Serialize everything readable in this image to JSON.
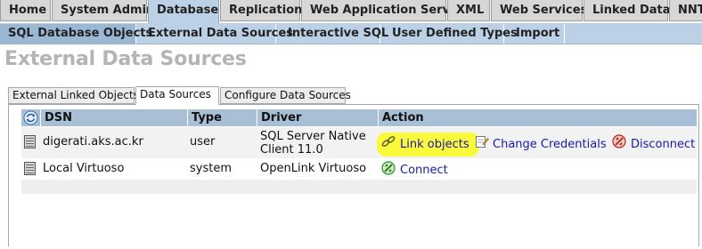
{
  "top_tabs": [
    {
      "label": "Home",
      "active": false
    },
    {
      "label": "System Admin",
      "active": false
    },
    {
      "label": "Database",
      "active": true
    },
    {
      "label": "Replication",
      "active": false
    },
    {
      "label": "Web Application Server",
      "active": false
    },
    {
      "label": "XML",
      "active": false
    },
    {
      "label": "Web Services",
      "active": false
    },
    {
      "label": "Linked Data",
      "active": false
    },
    {
      "label": "NNTP",
      "active": false
    }
  ],
  "sub_tabs": [
    {
      "label": "SQL Database Objects",
      "active": true
    },
    {
      "label": "External Data Sources",
      "active": false
    },
    {
      "label": "Interactive SQL",
      "active": false
    },
    {
      "label": "User Defined Types",
      "active": false
    },
    {
      "label": "Import",
      "active": false
    }
  ],
  "page_title": "External Data Sources",
  "inner_tabs": [
    {
      "label": "External Linked Objects",
      "active": false
    },
    {
      "label": "Data Sources",
      "active": true
    },
    {
      "label": "Configure Data Sources",
      "active": false
    }
  ],
  "table": {
    "columns": {
      "dsn": "DSN",
      "type": "Type",
      "driver": "Driver",
      "action": "Action"
    },
    "rows": [
      {
        "dsn": "digerati.aks.ac.kr",
        "type": "user",
        "driver_line1": "SQL Server Native",
        "driver_line2": "Client 11.0",
        "actions": [
          "Link objects",
          "Change Credentials",
          "Disconnect"
        ],
        "icons": [
          "database-icon",
          "chain-link-icon",
          "edit-pencil-icon",
          "disconnect-icon"
        ]
      },
      {
        "dsn": "Local Virtuoso",
        "type": "system",
        "driver": "OpenLink Virtuoso",
        "actions": [
          "Connect"
        ],
        "icons": [
          "database-icon",
          "connect-icon"
        ]
      }
    ]
  },
  "colors": {
    "tab_bg": "#d7d7d7",
    "tab_active": "#bcd1e6",
    "subbar": "#bcd1e6",
    "table_header": "#a9bfd6",
    "title_gray": "#b4b4b4",
    "link": "#1a1aa6",
    "highlight": "#fafa2a"
  }
}
